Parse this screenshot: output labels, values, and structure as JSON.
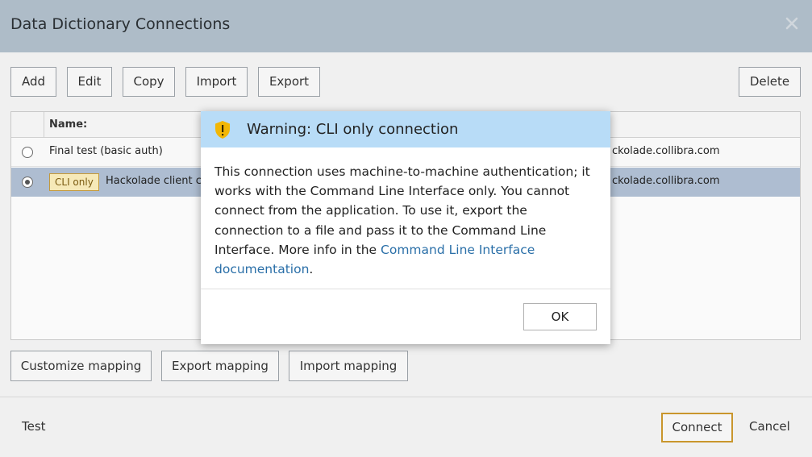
{
  "window": {
    "title": "Data Dictionary Connections"
  },
  "toolbar": {
    "add": "Add",
    "edit": "Edit",
    "copy": "Copy",
    "import": "Import",
    "export": "Export",
    "delete": "Delete"
  },
  "grid": {
    "header_name": "Name:",
    "rows": [
      {
        "name": "Final test (basic auth)",
        "host": "ckolade.collibra.com",
        "selected": false
      },
      {
        "badge": "CLI only",
        "name": "Hackolade client cr",
        "host": "ckolade.collibra.com",
        "selected": true
      }
    ]
  },
  "mapping": {
    "customize": "Customize mapping",
    "export": "Export mapping",
    "import": "Import mapping"
  },
  "footer": {
    "test": "Test",
    "connect": "Connect",
    "cancel": "Cancel"
  },
  "modal": {
    "title": "Warning: CLI only connection",
    "body_text": "This connection uses machine-to-machine authentication; it works with the Command Line Interface only. You cannot connect from the application. To use it, export the connection to a file and pass it to the Command Line Interface. More info in the ",
    "link_text": "Command Line Interface documentation",
    "body_end": ".",
    "ok": "OK"
  },
  "colors": {
    "titlebar": "#aebcc8",
    "modal_header": "#b8dcf7",
    "selected_row": "#aebdd1",
    "link": "#2a6fa8",
    "connect_border": "#c9962d",
    "warning_icon": "#f2b705"
  },
  "icons": {
    "close": "close-icon",
    "warning": "warning-shield-icon"
  }
}
